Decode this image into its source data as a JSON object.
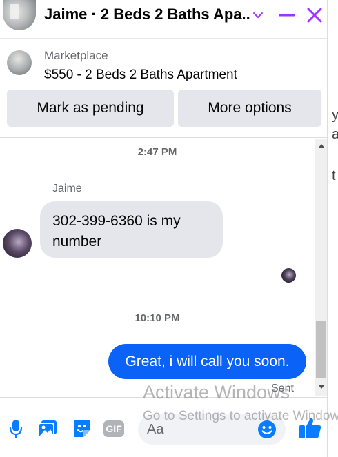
{
  "header": {
    "title": "Jaime · 2 Beds 2 Baths Apa...",
    "icons": [
      "chevron-down-icon",
      "minimize-icon",
      "close-icon"
    ],
    "accent_color": "#a033ff"
  },
  "marketplace": {
    "label": "Marketplace",
    "listing": "$550 - 2 Beds 2 Baths Apartment",
    "buttons": {
      "pending": "Mark as pending",
      "more": "More options"
    }
  },
  "background_page": {
    "fragments": [
      "y",
      "a",
      "t"
    ]
  },
  "thread": {
    "time_1": "2:47 PM",
    "sender": "Jaime",
    "incoming_message": "302-399-6360 is my number",
    "time_2": "10:10 PM",
    "outgoing_message": "Great, i will call you soon.",
    "status": "Sent",
    "outgoing_color": "#0a62f6"
  },
  "composer": {
    "placeholder": "Aa",
    "icons": [
      "microphone-icon",
      "photo-icon",
      "sticker-icon",
      "gif-icon",
      "emoji-icon",
      "like-icon"
    ],
    "gif_label": "GIF",
    "icon_color": "#0a7cff"
  },
  "watermark": {
    "line1": "Activate Windows",
    "line2": "Go to Settings to activate Windows."
  }
}
